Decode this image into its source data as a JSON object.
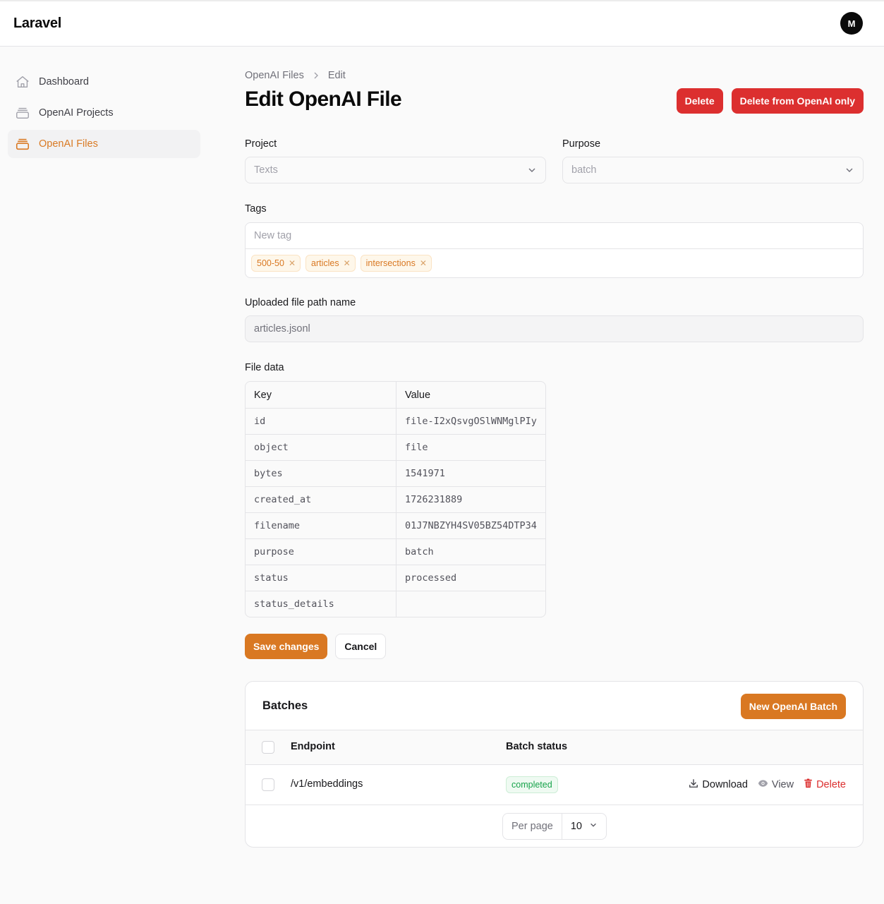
{
  "app": {
    "brand": "Laravel",
    "user_initial": "M"
  },
  "sidebar": {
    "items": [
      {
        "label": "Dashboard",
        "icon": "home-icon",
        "active": false
      },
      {
        "label": "OpenAI Projects",
        "icon": "stack-icon",
        "active": false
      },
      {
        "label": "OpenAI Files",
        "icon": "stack-icon",
        "active": true
      }
    ]
  },
  "breadcrumb": {
    "parent": "OpenAI Files",
    "current": "Edit"
  },
  "page": {
    "title": "Edit OpenAI File",
    "delete_label": "Delete",
    "delete_openai_label": "Delete from OpenAI only"
  },
  "form": {
    "project": {
      "label": "Project",
      "value": "Texts"
    },
    "purpose": {
      "label": "Purpose",
      "value": "batch"
    },
    "tags": {
      "label": "Tags",
      "placeholder": "New tag",
      "items": [
        "500-50",
        "articles",
        "intersections"
      ]
    },
    "uploaded_path": {
      "label": "Uploaded file path name",
      "value": "articles.jsonl"
    },
    "file_data": {
      "label": "File data",
      "key_header": "Key",
      "value_header": "Value",
      "rows": [
        {
          "key": "id",
          "value": "file-I2xQsvgOSlWNMglPIy"
        },
        {
          "key": "object",
          "value": "file"
        },
        {
          "key": "bytes",
          "value": "1541971"
        },
        {
          "key": "created_at",
          "value": "1726231889"
        },
        {
          "key": "filename",
          "value": "01J7NBZYH4SV05BZ54DTP34"
        },
        {
          "key": "purpose",
          "value": "batch"
        },
        {
          "key": "status",
          "value": "processed"
        },
        {
          "key": "status_details",
          "value": ""
        }
      ]
    },
    "save_label": "Save changes",
    "cancel_label": "Cancel"
  },
  "batches": {
    "title": "Batches",
    "new_label": "New OpenAI Batch",
    "columns": {
      "endpoint": "Endpoint",
      "status": "Batch status"
    },
    "rows": [
      {
        "endpoint": "/v1/embeddings",
        "status": "completed"
      }
    ],
    "actions": {
      "download": "Download",
      "view": "View",
      "delete": "Delete"
    },
    "per_page_label": "Per page",
    "per_page_value": "10"
  },
  "colors": {
    "accent": "#d97822",
    "danger": "#dc2f2f",
    "success": "#16a34a"
  }
}
